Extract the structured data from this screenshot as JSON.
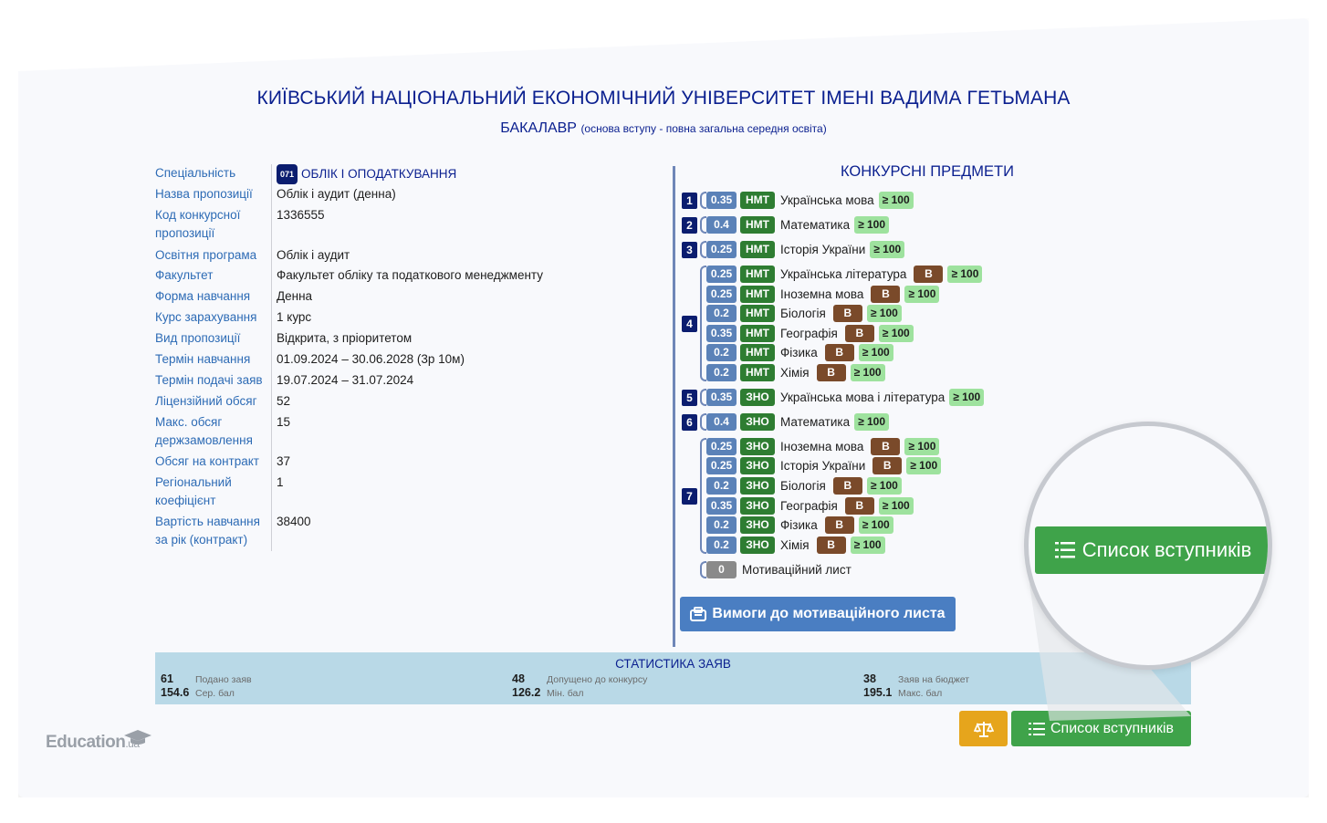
{
  "header": {
    "university": "КИЇВСЬКИЙ НАЦІОНАЛЬНИЙ ЕКОНОМІЧНИЙ УНІВЕРСИТЕТ ІМЕНІ ВАДИМА ГЕТЬМАНА",
    "degree": "БАКАЛАВР",
    "basis": "(основа вступу - повна загальна середня освіта)"
  },
  "info": {
    "specialty": {
      "label": "Спеціальність",
      "code": "071",
      "name": "ОБЛІК І ОПОДАТКУВАННЯ"
    },
    "rows": [
      {
        "label": "Назва пропозиції",
        "value": "Облік і аудит (денна)"
      },
      {
        "label": "Код конкурсної пропозиції",
        "value": "1336555"
      },
      {
        "label": "Освітня програма",
        "value": "Облік і аудит"
      },
      {
        "label": "Факультет",
        "value": "Факультет обліку та податкового менеджменту"
      },
      {
        "label": "Форма навчання",
        "value": "Денна"
      },
      {
        "label": "Курс зарахування",
        "value": "1 курс"
      },
      {
        "label": "Вид пропозиції",
        "value": "Відкрита, з пріоритетом"
      },
      {
        "label": "Термін навчання",
        "value": "01.09.2024 – 30.06.2028 (3р 10м)"
      },
      {
        "label": "Термін подачі заяв",
        "value": "19.07.2024 – 31.07.2024"
      },
      {
        "label": "Ліцензійний обсяг",
        "value": "52"
      },
      {
        "label": "Макс. обсяг держзамовлення",
        "value": "15"
      },
      {
        "label": "Обсяг на контракт",
        "value": "37"
      },
      {
        "label": "Регіональний коефіцієнт",
        "value": "1"
      },
      {
        "label": "Вартість навчання за рік (контракт)",
        "value": "38400"
      }
    ]
  },
  "subjects": {
    "title": "КОНКУРСНІ ПРЕДМЕТИ",
    "groups": [
      {
        "num": "1",
        "items": [
          {
            "coef": "0.35",
            "type": "НМТ",
            "name": "Українська мова",
            "b": "",
            "min": "≥ 100"
          }
        ]
      },
      {
        "num": "2",
        "items": [
          {
            "coef": "0.4",
            "type": "НМТ",
            "name": "Математика",
            "b": "",
            "min": "≥ 100"
          }
        ]
      },
      {
        "num": "3",
        "items": [
          {
            "coef": "0.25",
            "type": "НМТ",
            "name": "Історія України",
            "b": "",
            "min": "≥ 100"
          }
        ]
      },
      {
        "num": "4",
        "items": [
          {
            "coef": "0.25",
            "type": "НМТ",
            "name": "Українська література",
            "b": "В",
            "min": "≥ 100"
          },
          {
            "coef": "0.25",
            "type": "НМТ",
            "name": "Іноземна мова",
            "b": "В",
            "min": "≥ 100"
          },
          {
            "coef": "0.2",
            "type": "НМТ",
            "name": "Біологія",
            "b": "В",
            "min": "≥ 100"
          },
          {
            "coef": "0.35",
            "type": "НМТ",
            "name": "Географія",
            "b": "В",
            "min": "≥ 100"
          },
          {
            "coef": "0.2",
            "type": "НМТ",
            "name": "Фізика",
            "b": "В",
            "min": "≥ 100"
          },
          {
            "coef": "0.2",
            "type": "НМТ",
            "name": "Хімія",
            "b": "В",
            "min": "≥ 100"
          }
        ]
      },
      {
        "num": "5",
        "items": [
          {
            "coef": "0.35",
            "type": "ЗНО",
            "name": "Українська мова і література",
            "b": "",
            "min": "≥ 100"
          }
        ]
      },
      {
        "num": "6",
        "items": [
          {
            "coef": "0.4",
            "type": "ЗНО",
            "name": "Математика",
            "b": "",
            "min": "≥ 100"
          }
        ]
      },
      {
        "num": "7",
        "items": [
          {
            "coef": "0.25",
            "type": "ЗНО",
            "name": "Іноземна мова",
            "b": "В",
            "min": "≥ 100"
          },
          {
            "coef": "0.25",
            "type": "ЗНО",
            "name": "Історія України",
            "b": "В",
            "min": "≥ 100"
          },
          {
            "coef": "0.2",
            "type": "ЗНО",
            "name": "Біологія",
            "b": "В",
            "min": "≥ 100"
          },
          {
            "coef": "0.35",
            "type": "ЗНО",
            "name": "Географія",
            "b": "В",
            "min": "≥ 100"
          },
          {
            "coef": "0.2",
            "type": "ЗНО",
            "name": "Фізика",
            "b": "В",
            "min": "≥ 100"
          },
          {
            "coef": "0.2",
            "type": "ЗНО",
            "name": "Хімія",
            "b": "В",
            "min": "≥ 100"
          }
        ]
      }
    ],
    "motivation": {
      "coef": "0",
      "name": "Мотиваційний лист"
    },
    "motivation_button": "Вимоги до мотиваційного листа"
  },
  "stats": {
    "title": "СТАТИСТИКА ЗАЯВ",
    "items": [
      {
        "value": "61",
        "label": "Подано заяв"
      },
      {
        "value": "154.6",
        "label": "Сер. бал"
      },
      {
        "value": "48",
        "label": "Допущено до конкурсу"
      },
      {
        "value": "126.2",
        "label": "Мін. бал"
      },
      {
        "value": "38",
        "label": "Заяв на бюджет"
      },
      {
        "value": "195.1",
        "label": "Макс. бал"
      }
    ]
  },
  "actions": {
    "applicants_list": "Список вступників"
  },
  "logo": {
    "main": "Education",
    "suffix": ".ua"
  },
  "colors": {
    "title": "#0a1f8f",
    "label": "#2d6bb5",
    "coef": "#5b82b8",
    "type": "#2e7d32",
    "b_mark": "#7a4a2a",
    "min": "#9ee29e",
    "list_button": "#3fa34a",
    "scale_button": "#e6a51c",
    "stats_bg": "#b9d9e7"
  }
}
